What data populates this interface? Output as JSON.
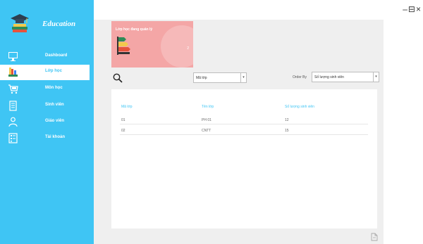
{
  "app": {
    "title": "Education"
  },
  "sidebar": {
    "items": [
      {
        "label": "Dashboard",
        "icon": "monitor-board-icon",
        "active": false
      },
      {
        "label": "Lớp học",
        "icon": "books-icon",
        "active": true
      },
      {
        "label": "Môn học",
        "icon": "cart-icon",
        "active": false
      },
      {
        "label": "Sinh viên",
        "icon": "document-icon",
        "active": false
      },
      {
        "label": "Giáo viên",
        "icon": "person-icon",
        "active": false
      },
      {
        "label": "Tài khoản",
        "icon": "list-icon",
        "active": false
      }
    ]
  },
  "window": {
    "controls": "–⊟×"
  },
  "card": {
    "title": "Lớp học đang quản lý",
    "value": "2"
  },
  "filter": {
    "selected": "Mã lớp"
  },
  "order": {
    "label": "Order By",
    "selected": "Số lượng sinh viên"
  },
  "table": {
    "headers": [
      "Mã lớp",
      "Tên lớp",
      "Số lượng sinh viên"
    ],
    "rows": [
      [
        "01",
        "PH 01",
        "12"
      ],
      [
        "02",
        "CNTT",
        "15"
      ]
    ]
  },
  "colors": {
    "accent": "#3fc5f4",
    "card": "#f4a6a6",
    "panel": "#efefef"
  }
}
